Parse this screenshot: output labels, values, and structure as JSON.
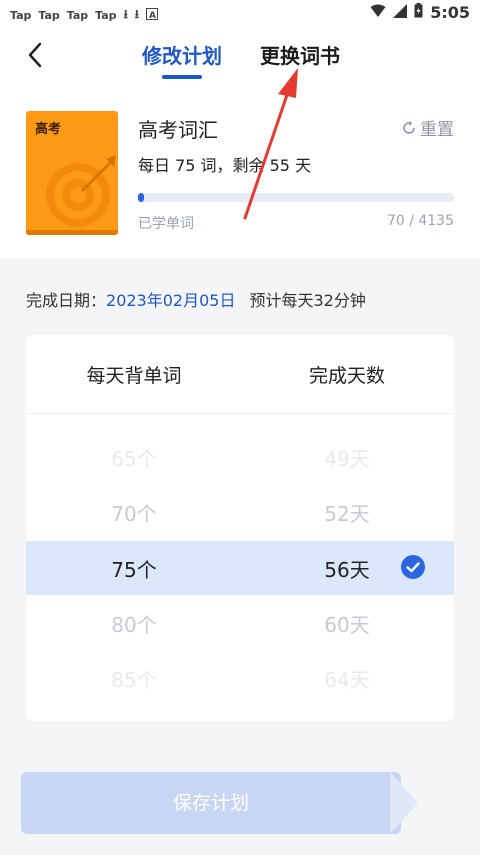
{
  "status_bar": {
    "notifications": [
      "Tap",
      "Tap",
      "Tap",
      "Tap"
    ],
    "time": "5:05"
  },
  "header": {
    "tab_active": "修改计划",
    "tab_inactive": "更换词书"
  },
  "book": {
    "cover_title": "高考",
    "title": "高考词汇",
    "subtitle": "每日 75 词，剩余 55 天",
    "reset_label": "重置",
    "learned_label": "已学单词",
    "learned_count": "70 / 4135",
    "progress_fraction": 0.017
  },
  "completion": {
    "label": "完成日期：",
    "date": "2023年02月05日",
    "estimate": "预计每天32分钟"
  },
  "picker": {
    "col_left": "每天背单词",
    "col_right": "完成天数",
    "rows": [
      {
        "words": "65个",
        "days": "49天"
      },
      {
        "words": "70个",
        "days": "52天"
      },
      {
        "words": "75个",
        "days": "56天"
      },
      {
        "words": "80个",
        "days": "60天"
      },
      {
        "words": "85个",
        "days": "64天"
      }
    ],
    "selected_index": 2
  },
  "save_button": "保存计划",
  "colors": {
    "accent": "#1f57c7",
    "progress": "#2b66e0",
    "selected_row": "#dbe7fb",
    "book_cover": "#ff9a17",
    "annotation": "#e53a30"
  }
}
